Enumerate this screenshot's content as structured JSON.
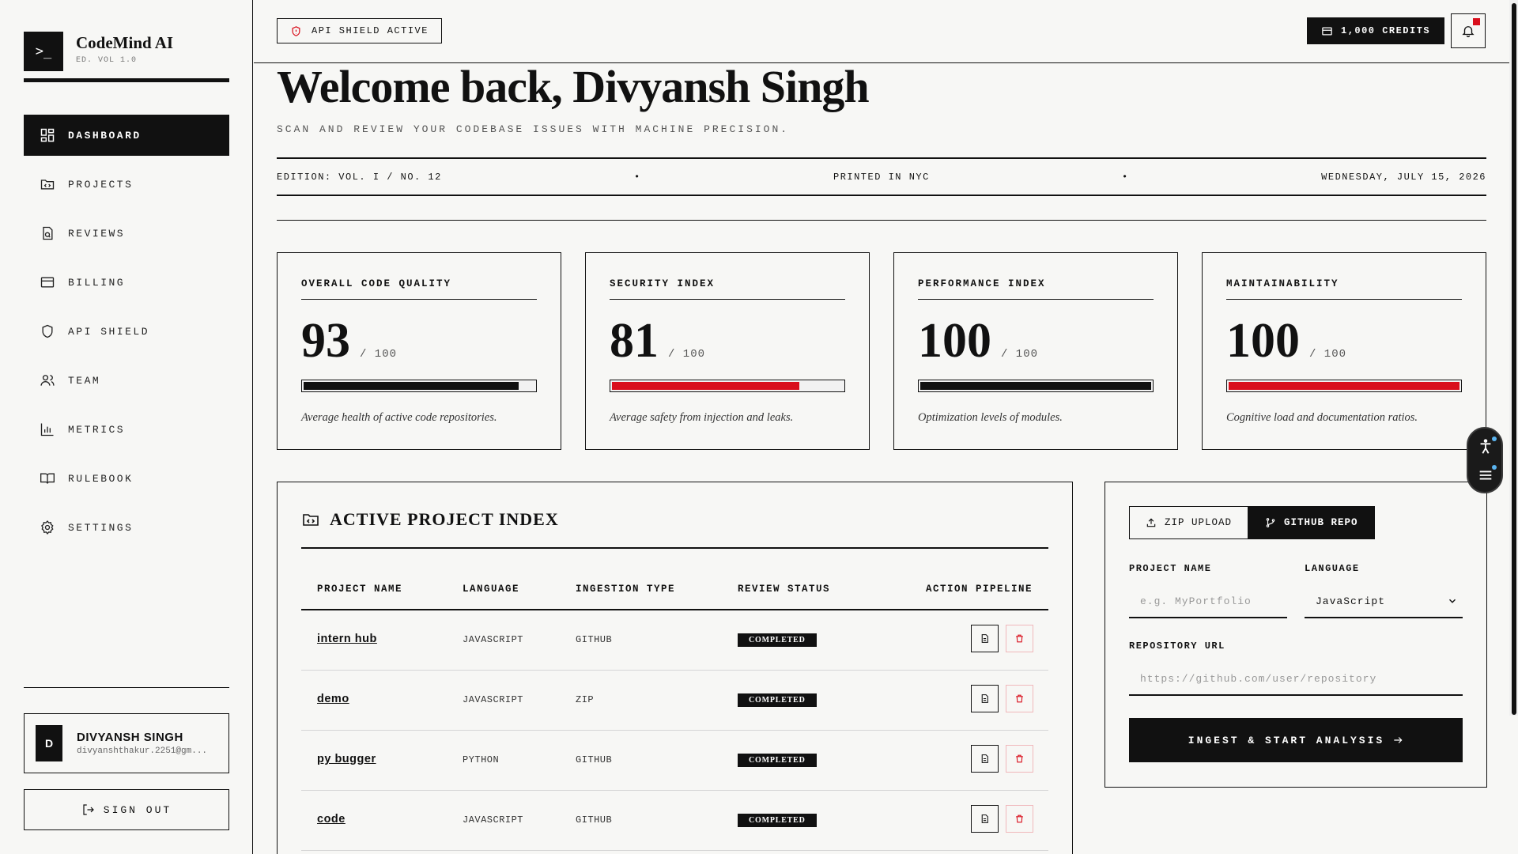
{
  "brand": {
    "icon_text": ">_",
    "name": "CodeMind AI",
    "edition": "ED. VOL 1.0"
  },
  "nav": [
    {
      "label": "DASHBOARD",
      "icon": "grid-icon",
      "active": true
    },
    {
      "label": "PROJECTS",
      "icon": "folder-code-icon"
    },
    {
      "label": "REVIEWS",
      "icon": "file-search-icon"
    },
    {
      "label": "BILLING",
      "icon": "credit-card-icon"
    },
    {
      "label": "API SHIELD",
      "icon": "shield-icon"
    },
    {
      "label": "TEAM",
      "icon": "users-icon"
    },
    {
      "label": "METRICS",
      "icon": "bar-chart-icon"
    },
    {
      "label": "RULEBOOK",
      "icon": "book-open-icon"
    },
    {
      "label": "SETTINGS",
      "icon": "gear-icon"
    }
  ],
  "user": {
    "initial": "D",
    "name": "DIVYANSH SINGH",
    "email": "divyanshthakur.2251@gm..."
  },
  "signout_label": "SIGN OUT",
  "topbar": {
    "shield_label": "API SHIELD ACTIVE",
    "credits_label": "1,000 CREDITS"
  },
  "hero": {
    "welcome": "Welcome back, Divyansh Singh",
    "subtitle": "SCAN AND REVIEW YOUR CODEBASE ISSUES WITH MACHINE PRECISION.",
    "edition": "EDITION: VOL. I / NO. 12",
    "bullet": "•",
    "printed": "PRINTED IN NYC",
    "date": "WEDNESDAY, JULY 15, 2026"
  },
  "metrics": [
    {
      "title": "OVERALL CODE QUALITY",
      "score": "93",
      "max": "/ 100",
      "value": 93,
      "bar_color": "#111111",
      "desc": "Average health of active code repositories."
    },
    {
      "title": "SECURITY INDEX",
      "score": "81",
      "max": "/ 100",
      "value": 81,
      "bar_color": "#d90f1c",
      "desc": "Average safety from injection and leaks."
    },
    {
      "title": "PERFORMANCE INDEX",
      "score": "100",
      "max": "/ 100",
      "value": 100,
      "bar_color": "#111111",
      "desc": "Optimization levels of modules."
    },
    {
      "title": "MAINTAINABILITY",
      "score": "100",
      "max": "/ 100",
      "value": 100,
      "bar_color": "#d90f1c",
      "desc": "Cognitive load and documentation ratios."
    }
  ],
  "projects": {
    "title": "ACTIVE PROJECT INDEX",
    "columns": [
      "PROJECT NAME",
      "LANGUAGE",
      "INGESTION TYPE",
      "REVIEW STATUS",
      "ACTION PIPELINE"
    ],
    "rows": [
      {
        "name": "intern hub",
        "language": "JAVASCRIPT",
        "type": "GITHUB",
        "status": "COMPLETED"
      },
      {
        "name": "demo",
        "language": "JAVASCRIPT",
        "type": "ZIP",
        "status": "COMPLETED"
      },
      {
        "name": "py bugger",
        "language": "PYTHON",
        "type": "GITHUB",
        "status": "COMPLETED"
      },
      {
        "name": "code",
        "language": "JAVASCRIPT",
        "type": "GITHUB",
        "status": "COMPLETED"
      }
    ]
  },
  "ingest": {
    "tabs": [
      {
        "label": "ZIP UPLOAD",
        "active": false
      },
      {
        "label": "GITHUB REPO",
        "active": true
      }
    ],
    "project_name_label": "PROJECT NAME",
    "project_name_placeholder": "e.g. MyPortfolio",
    "language_label": "LANGUAGE",
    "language_value": "JavaScript",
    "repo_label": "REPOSITORY URL",
    "repo_placeholder": "https://github.com/user/repository",
    "start_label": "INGEST & START ANALYSIS"
  },
  "colors": {
    "ink": "#111111",
    "accent": "#d90f1c",
    "paper": "#f7f7f5"
  }
}
